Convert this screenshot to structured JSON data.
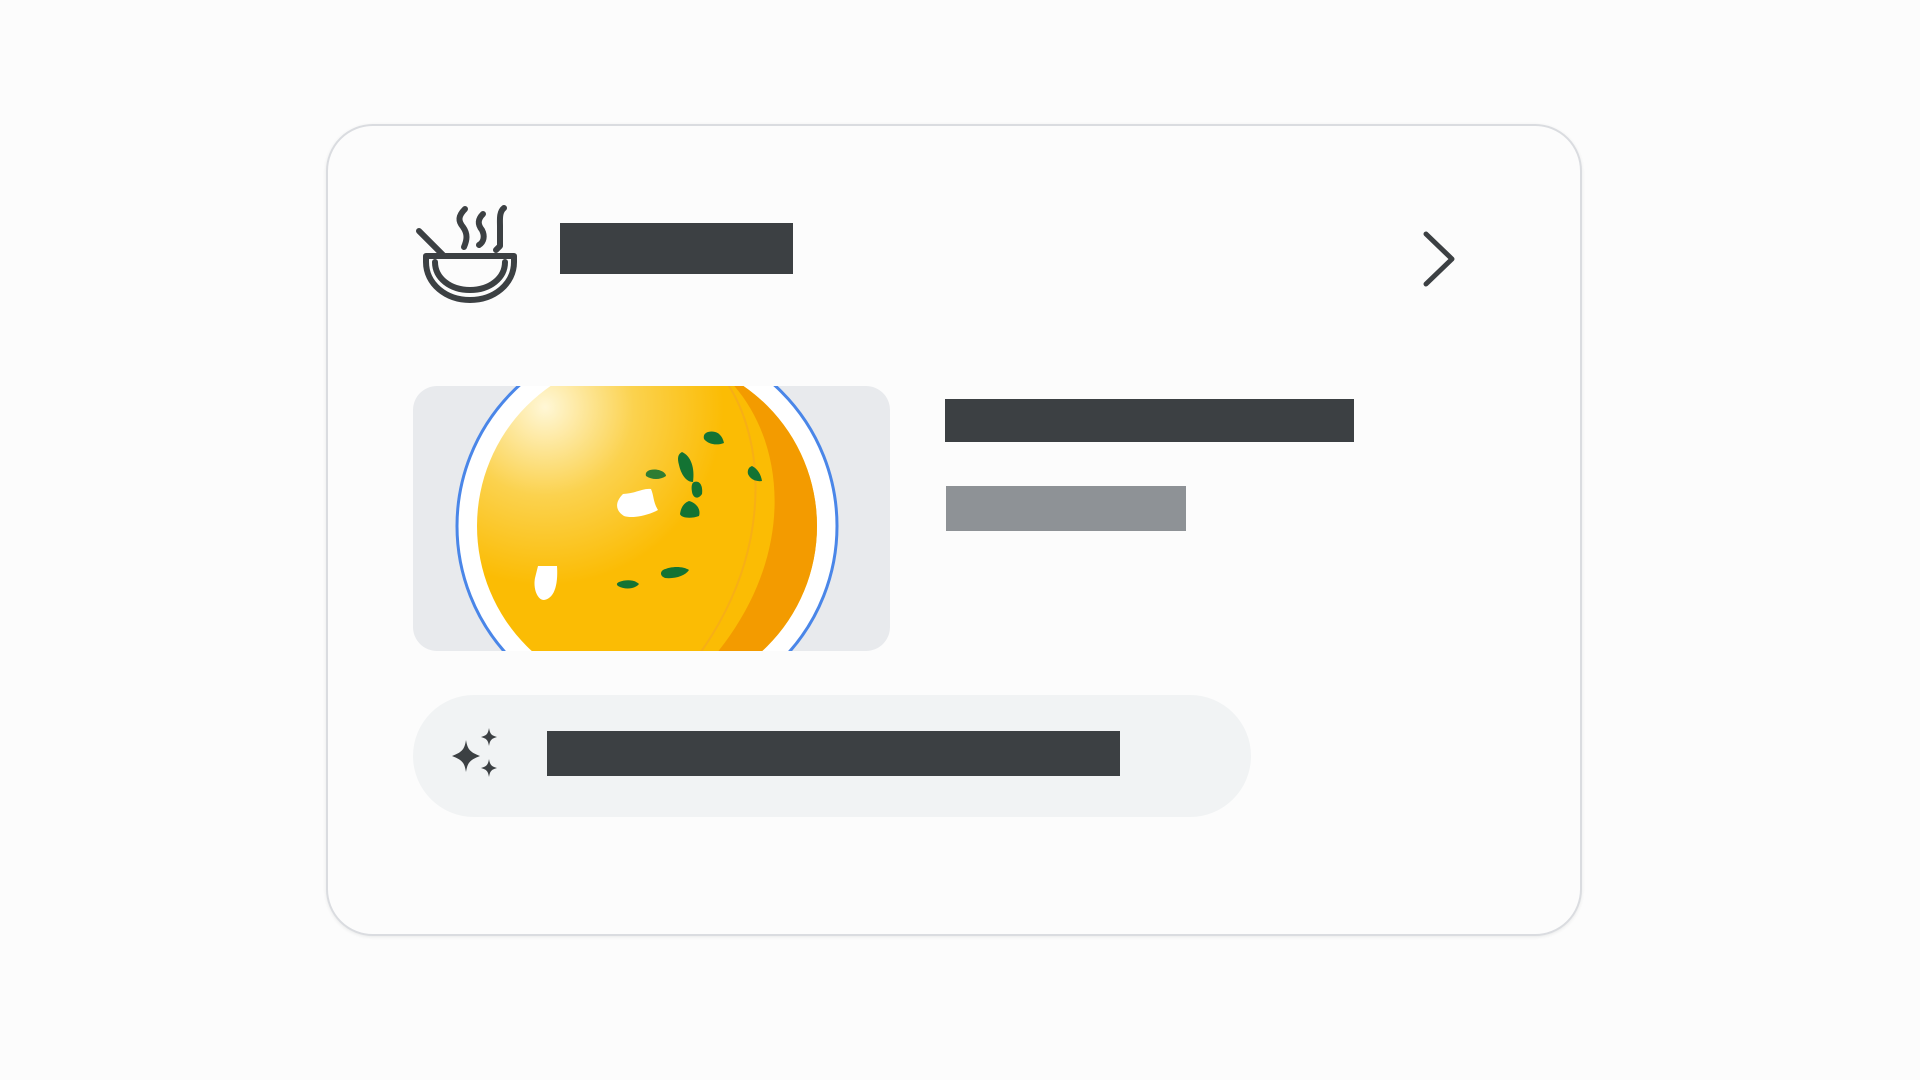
{
  "card": {
    "header": {
      "icon": "soup-bowl-icon",
      "title_redacted": "",
      "chevron_icon": "chevron-right-icon"
    },
    "item": {
      "image": "soup-bowl-image",
      "title_redacted": "",
      "subtitle_redacted": ""
    },
    "suggestion": {
      "icon": "sparkle-icon",
      "label_redacted": ""
    }
  },
  "colors": {
    "page_background": "#fcfcfc",
    "card_border": "#dadce0",
    "redaction_dark": "#3c4043",
    "redaction_gray": "#8e9296",
    "thumbnail_background": "#e8eaed",
    "pill_background": "#f1f3f4",
    "soup_yellow": "#fbbc04",
    "soup_orange": "#f29900",
    "herb_green": "#137333",
    "bowl_rim_blue": "#4285f4"
  }
}
